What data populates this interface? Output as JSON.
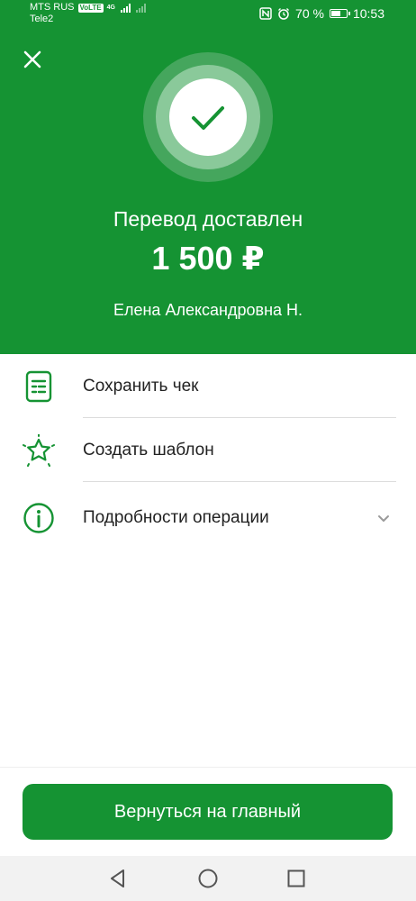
{
  "status_bar": {
    "carrier1": "MTS RUS",
    "volte": "VoLTE",
    "network": "4G",
    "carrier2": "Tele2",
    "battery_percent": "70 %",
    "battery_level": 0.7,
    "time": "10:53"
  },
  "header": {
    "title": "Перевод доставлен",
    "amount": "1 500 ₽",
    "recipient": "Елена Александровна Н.",
    "icons": {
      "close": "close-icon",
      "status": "check-icon"
    }
  },
  "actions": [
    {
      "label": "Сохранить чек",
      "icon": "receipt-icon"
    },
    {
      "label": "Создать шаблон",
      "icon": "star-icon"
    },
    {
      "label": "Подробности операции",
      "icon": "info-icon"
    }
  ],
  "main_button": {
    "label": "Вернуться на главный"
  },
  "nav": {
    "back": "back-icon",
    "home": "home-icon",
    "recents": "recents-icon"
  },
  "colors": {
    "brand": "#159333",
    "text": "#222222",
    "divider": "#dcdcdc"
  }
}
